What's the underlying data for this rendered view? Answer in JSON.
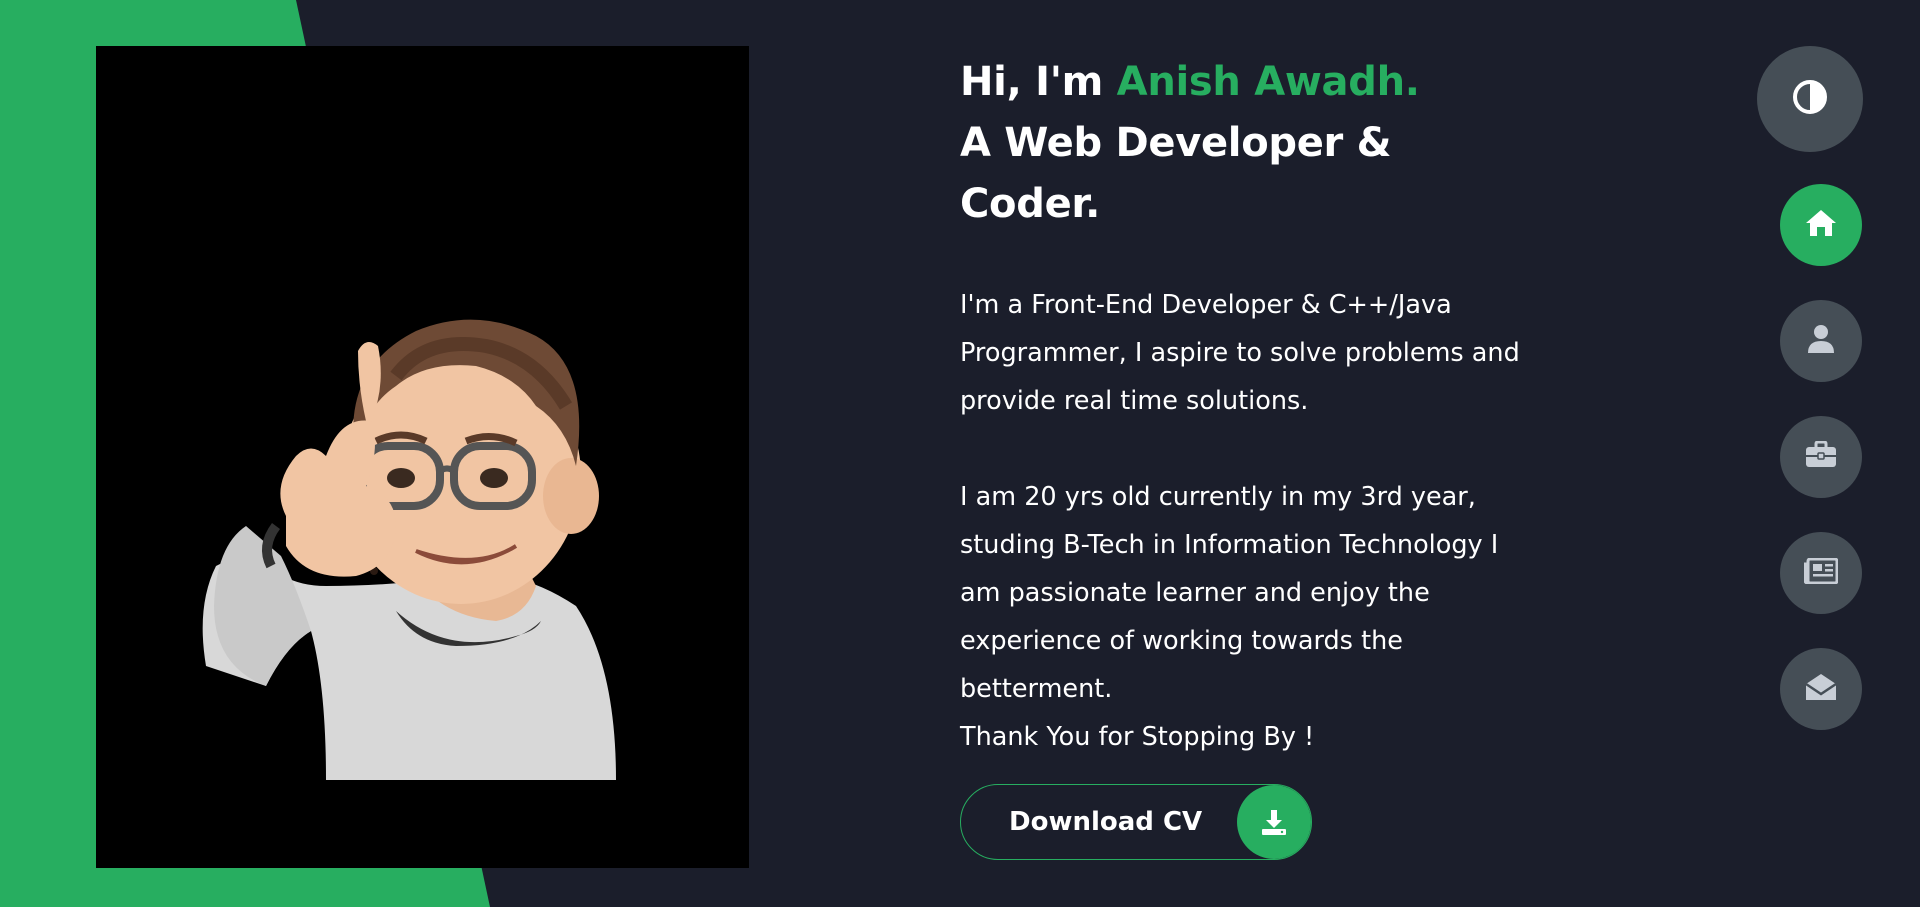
{
  "hero": {
    "greeting": "Hi, I'm",
    "name": "Anish Awadh.",
    "tagline_line1": "A Web Developer &",
    "tagline_line2": "Coder.",
    "bio_paragraph1": "I'm a Front-End Developer & C++/Java Programmer, I aspire to solve problems and provide real time solutions.",
    "bio_paragraph2": "I am 20 yrs old currently in my 3rd year, studing B-Tech in Information Technology I am passionate learner and enjoy the experience of working towards the betterment.",
    "bio_closing": "Thank You for Stopping By !"
  },
  "download_button": {
    "label": "Download CV",
    "icon": "download-icon"
  },
  "sidebar_nav": {
    "theme_toggle_icon": "contrast-icon",
    "items": [
      {
        "name": "home",
        "icon": "home-icon",
        "active": true
      },
      {
        "name": "about",
        "icon": "user-icon",
        "active": false
      },
      {
        "name": "portfolio",
        "icon": "briefcase-icon",
        "active": false
      },
      {
        "name": "blogs",
        "icon": "newspaper-icon",
        "active": false
      },
      {
        "name": "contact",
        "icon": "envelope-open-icon",
        "active": false
      }
    ]
  },
  "colors": {
    "accent": "#27ae60",
    "background": "#1b1e2b",
    "nav_button": "#454e56",
    "text": "#ffffff"
  }
}
